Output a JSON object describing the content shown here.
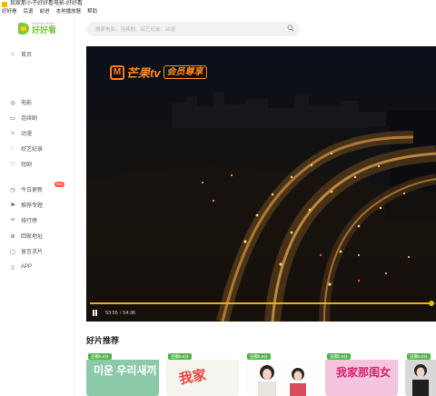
{
  "window": {
    "title": "我家那小子好好看电影-好好看",
    "icon": "app-icon"
  },
  "menu": [
    "好好看",
    "后退",
    "前进",
    "本地播放器",
    "帮助"
  ],
  "logo": {
    "main": "好好看",
    "sub": "HAOHAOKAN"
  },
  "nav": {
    "group1": [
      {
        "label": "首页",
        "icon": "home-icon"
      }
    ],
    "group2": [
      {
        "label": "电影",
        "icon": "film-icon"
      },
      {
        "label": "连续剧",
        "icon": "tv-icon"
      },
      {
        "label": "动漫",
        "icon": "anime-icon"
      },
      {
        "label": "综艺纪录",
        "icon": "variety-icon"
      },
      {
        "label": "短剧",
        "icon": "heart-icon"
      }
    ],
    "group3": [
      {
        "label": "今日更新",
        "icon": "clock-icon",
        "badge": "999"
      },
      {
        "label": "推荐专题",
        "icon": "flag-icon"
      },
      {
        "label": "排行榜",
        "icon": "chart-icon"
      },
      {
        "label": "回家地址",
        "icon": "home-link-icon"
      },
      {
        "label": "留言求片",
        "icon": "message-icon"
      },
      {
        "label": "APP",
        "icon": "phone-icon"
      }
    ]
  },
  "search": {
    "placeholder": "搜索电影、连续剧、综艺纪录、动漫"
  },
  "player": {
    "brand_name": "芒果tv",
    "brand_vip": "会员尊享",
    "current_time": "53:55",
    "duration": "54:36",
    "progress": 0.987
  },
  "section": {
    "title": "好片推荐"
  },
  "cards": [
    {
      "score": "豆瓣6.8分",
      "art_text": "미운 우리새끼",
      "bg": "#8cc9a8"
    },
    {
      "score": "豆瓣5.9分",
      "art_text": "我家",
      "bg": "#f6f4ef"
    },
    {
      "score": "豆瓣5.9分",
      "art_text": "",
      "bg": "#fdfdfd"
    },
    {
      "score": "豆瓣5.9分",
      "art_text": "我家那闺女",
      "bg": "#f5c4de"
    },
    {
      "score": "豆瓣6.0分",
      "art_text": "",
      "bg": "#d8d8d8"
    }
  ]
}
